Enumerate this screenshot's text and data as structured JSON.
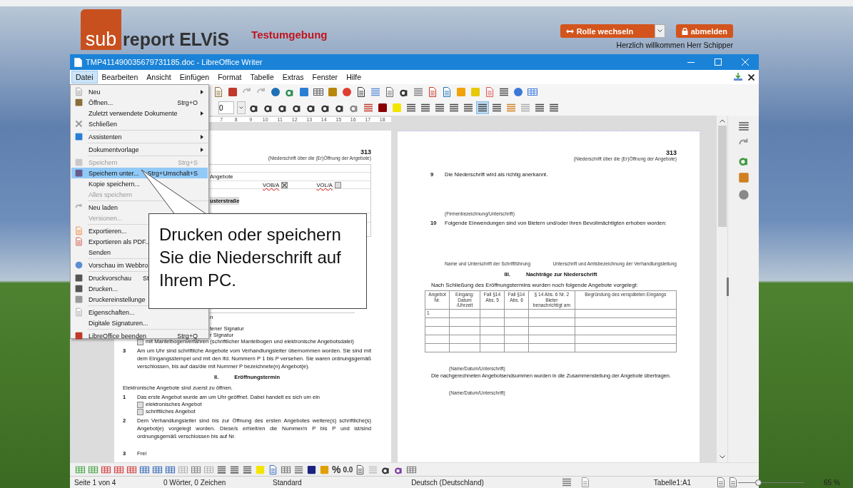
{
  "header": {
    "logo_prefix": "sub",
    "logo_name": "report ELViS",
    "environment": "Testumgebung",
    "role_button": "Rolle wechseln",
    "logout_button": "abmelden",
    "welcome": "Herzlich willkommen Herr Schipper"
  },
  "window": {
    "title": "TMP411490035679731185.doc - LibreOffice Writer"
  },
  "menubar": [
    {
      "label": "Datei",
      "selected": true
    },
    {
      "label": "Bearbeiten",
      "selected": false
    },
    {
      "label": "Ansicht",
      "selected": false
    },
    {
      "label": "Einfügen",
      "selected": false
    },
    {
      "label": "Format",
      "selected": false
    },
    {
      "label": "Tabelle",
      "selected": false
    },
    {
      "label": "Extras",
      "selected": false
    },
    {
      "label": "Fenster",
      "selected": false
    },
    {
      "label": "Hilfe",
      "selected": false
    }
  ],
  "file_menu": [
    [
      {
        "label": "Neu",
        "submenu": true,
        "disabled": false,
        "selected": false
      },
      {
        "label": "Öffnen...",
        "shortcut": "Strg+O",
        "submenu": false,
        "disabled": false,
        "selected": false
      },
      {
        "label": "Zuletzt verwendete Dokumente",
        "submenu": true,
        "disabled": false,
        "selected": false
      },
      {
        "label": "Schließen",
        "submenu": false,
        "disabled": false,
        "selected": false
      }
    ],
    [
      {
        "label": "Assistenten",
        "submenu": true,
        "disabled": false,
        "selected": false
      }
    ],
    [
      {
        "label": "Dokumentvorlage",
        "submenu": true,
        "disabled": false,
        "selected": false
      }
    ],
    [
      {
        "label": "Speichern",
        "shortcut": "Strg+S",
        "submenu": false,
        "disabled": true,
        "selected": false
      },
      {
        "label": "Speichern unter...",
        "shortcut": "Strg+Umschalt+S",
        "submenu": false,
        "disabled": false,
        "selected": true
      },
      {
        "label": "Kopie speichern...",
        "submenu": false,
        "disabled": false,
        "selected": false
      },
      {
        "label": "Alles speichern",
        "submenu": false,
        "disabled": true,
        "selected": false
      }
    ],
    [
      {
        "label": "Neu laden",
        "submenu": false,
        "disabled": false,
        "selected": false
      },
      {
        "label": "Versionen...",
        "submenu": false,
        "disabled": true,
        "selected": false
      }
    ],
    [
      {
        "label": "Exportieren...",
        "submenu": false,
        "disabled": false,
        "selected": false
      },
      {
        "label": "Exportieren als PDF..",
        "submenu": false,
        "disabled": false,
        "selected": false
      },
      {
        "label": "Senden",
        "submenu": false,
        "disabled": false,
        "selected": false
      }
    ],
    [
      {
        "label": "Vorschau im Webbro",
        "submenu": false,
        "disabled": false,
        "selected": false
      }
    ],
    [
      {
        "label": "Druckvorschau",
        "shortcut": "St",
        "submenu": false,
        "disabled": false,
        "selected": false
      },
      {
        "label": "Drucken...",
        "submenu": false,
        "disabled": false,
        "selected": false
      },
      {
        "label": "Druckereinstellunge",
        "submenu": false,
        "disabled": false,
        "selected": false
      }
    ],
    [
      {
        "label": "Eigenschaften...",
        "submenu": false,
        "disabled": false,
        "selected": false
      },
      {
        "label": "Digitale Signaturen...",
        "submenu": false,
        "disabled": false,
        "selected": false
      }
    ],
    [
      {
        "label": "LibreOffice beenden",
        "shortcut": "Strg+Q",
        "submenu": false,
        "disabled": false,
        "selected": false
      }
    ]
  ],
  "callout": {
    "text": "Drucken oder speichern Sie die Niederschrift auf Ihrem PC."
  },
  "toolbar": {
    "font_size": "0",
    "justify_active": true
  },
  "ruler": [
    "7",
    "8",
    "9",
    "10",
    "11",
    "12",
    "13",
    "14",
    "15",
    "16",
    "17",
    "18"
  ],
  "left_page": {
    "page_number": "313",
    "header_note": "(Niederschrift über die (Er)Öffnung der Angebote)",
    "table_text": "Angebote",
    "procedures": [
      {
        "label": "VOB/A",
        "checked": true
      },
      {
        "label": "VOL/A",
        "checked": false
      }
    ],
    "street": "usterstraße",
    "fragment": "n",
    "signature_lines": [
      "tener Signatur",
      "r Signatur"
    ],
    "blocks": [
      {
        "kind": "checkbox",
        "label": "mit Mantelbogenverfahren (schriftlicher Mantelbogen und elektronische Angebotsdatei)",
        "checked": false
      },
      {
        "kind": "numbered",
        "number": "3",
        "text": "Am um Uhr sind schriftliche Angebote vom Verhandlungsleiter übernommen worden. Sie sind mit dem Eingangsstempel und mit den lfd. Nummern P 1 bis P versehen. Sie waren ordnungsgemäß verschlossen, bis auf das/die mit Nummer P bezeichnete(n) Angebot(e)."
      },
      {
        "kind": "heading",
        "number": "II.",
        "text": "Eröffnungstermin"
      },
      {
        "kind": "paragraph",
        "text": "Elektronische Angebote sind zuerst zu öffnen."
      },
      {
        "kind": "numbered",
        "number": "1",
        "text": "Das erste Angebot wurde am um Uhr geöffnet. Dabei handelt es sich um ein"
      },
      {
        "kind": "checkbox",
        "label": "elektronisches Angebot",
        "checked": false
      },
      {
        "kind": "checkbox",
        "label": "schriftliches Angebot",
        "checked": false
      },
      {
        "kind": "numbered",
        "number": "2",
        "text": "Dem Verhandlungsleiter sind bis zur Öffnung des ersten Angebotes weitere(s) schriftliche(s) Angebot(e) vorgelegt worden. Diese/s erhielt/en die Nummer/n P bis P und ist/sind ordnungsgemäß verschlossen bis auf Nr."
      },
      {
        "kind": "numbered",
        "number": "3",
        "text": "Frei"
      }
    ]
  },
  "right_page": {
    "page_number": "313",
    "header_note": "(Niederschrift über die (Er)Öffnung der Angebote)",
    "item9": {
      "number": "9",
      "text": "Die Niederschrift wird als richtig anerkannt."
    },
    "company_signature": "(Firmenbezeichnung/Unterschrift)",
    "item10": {
      "number": "10",
      "text": "Folgende Einwendungen sind von Bietern und/oder ihren Bevollmächtigten erhoben worden:"
    },
    "signatures": [
      "Name und Unterschrift der Schriftführung",
      "Unterschrift und Amtsbezeichnung der Verhandlungsleitung"
    ],
    "section": {
      "number": "III.",
      "title": "Nachträge zur Niederschrift"
    },
    "intro": "Nach Schließung des Eröffnungstermins wurden noch folgende Angebote vorgelegt:",
    "table": {
      "columns": [
        "Angebot Nr.",
        "Eingang: Datum /Uhrzeit",
        "Fall §14 Abs. 5",
        "Fall §14 Abs. 6",
        "§ 14 Abs. 6 Nr. 2 Bieter benachrichtigt am",
        "Begründung des verspäteten Eingangs"
      ],
      "rows": [
        [
          "1",
          "",
          "",
          "",
          "",
          ""
        ],
        [
          "",
          "",
          "",
          "",
          "",
          ""
        ],
        [
          "",
          "",
          "",
          "",
          "",
          ""
        ],
        [
          "",
          "",
          "",
          "",
          "",
          ""
        ],
        [
          "",
          "",
          "",
          "",
          "",
          ""
        ]
      ]
    },
    "signature_note_1": "(Name/Datum/Unterschrift)",
    "closing": "Die nachgerechneten Angebotsendsummen wurden in die Zusammenstellung der Angebote übertragen.",
    "signature_note_2": "(Name/Datum/Unterschrift)"
  },
  "table_toolbar": {
    "percent": "%",
    "decimal": "0.0"
  },
  "status_bar": {
    "page": "Seite 1 von 4",
    "words": "0 Wörter, 0 Zeichen",
    "style": "Standard",
    "language": "Deutsch (Deutschland)",
    "cell": "Tabelle1:A1",
    "zoom": "65 %",
    "zoom_slider": {
      "level": 0.3
    }
  }
}
